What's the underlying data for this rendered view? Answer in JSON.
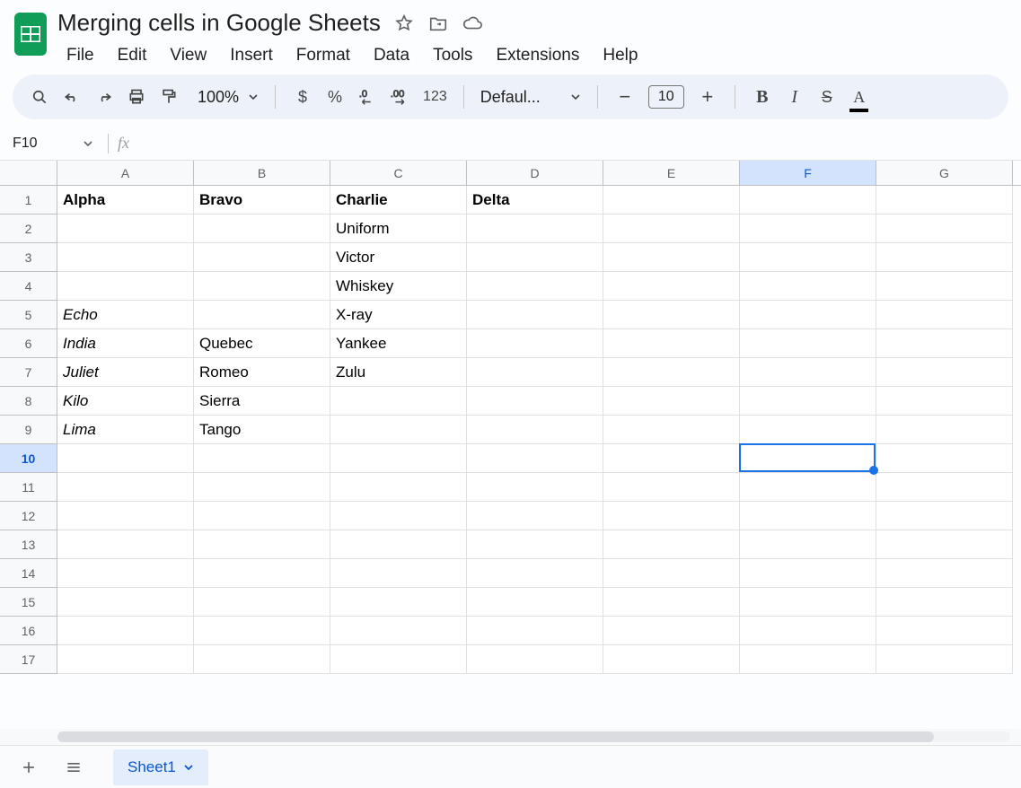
{
  "doc": {
    "title": "Merging cells in Google Sheets"
  },
  "menus": [
    "File",
    "Edit",
    "View",
    "Insert",
    "Format",
    "Data",
    "Tools",
    "Extensions",
    "Help"
  ],
  "toolbar": {
    "zoom": "100%",
    "font": "Defaul...",
    "font_size": "10",
    "number_fmt": "123"
  },
  "namebox": {
    "ref": "F10"
  },
  "columns": [
    "A",
    "B",
    "C",
    "D",
    "E",
    "F",
    "G"
  ],
  "active_col_index": 5,
  "active_row_index": 9,
  "row_count": 17,
  "selection": {
    "col": 5,
    "row": 9
  },
  "cells": {
    "r1": {
      "A": {
        "t": "Alpha",
        "b": true
      },
      "B": {
        "t": "Bravo",
        "b": true
      },
      "C": {
        "t": "Charlie",
        "b": true
      },
      "D": {
        "t": "Delta",
        "b": true
      }
    },
    "r2": {
      "C": {
        "t": "Uniform"
      }
    },
    "r3": {
      "C": {
        "t": "Victor"
      }
    },
    "r4": {
      "C": {
        "t": "Whiskey"
      }
    },
    "r5": {
      "A": {
        "t": "Echo",
        "i": true
      },
      "C": {
        "t": "X-ray"
      }
    },
    "r6": {
      "A": {
        "t": "India",
        "i": true
      },
      "B": {
        "t": "Quebec"
      },
      "C": {
        "t": "Yankee"
      }
    },
    "r7": {
      "A": {
        "t": "Juliet",
        "i": true
      },
      "B": {
        "t": "Romeo"
      },
      "C": {
        "t": "Zulu"
      }
    },
    "r8": {
      "A": {
        "t": "Kilo",
        "i": true
      },
      "B": {
        "t": "Sierra"
      }
    },
    "r9": {
      "A": {
        "t": "Lima",
        "i": true
      },
      "B": {
        "t": "Tango"
      }
    }
  },
  "sheet_tab": {
    "name": "Sheet1"
  }
}
